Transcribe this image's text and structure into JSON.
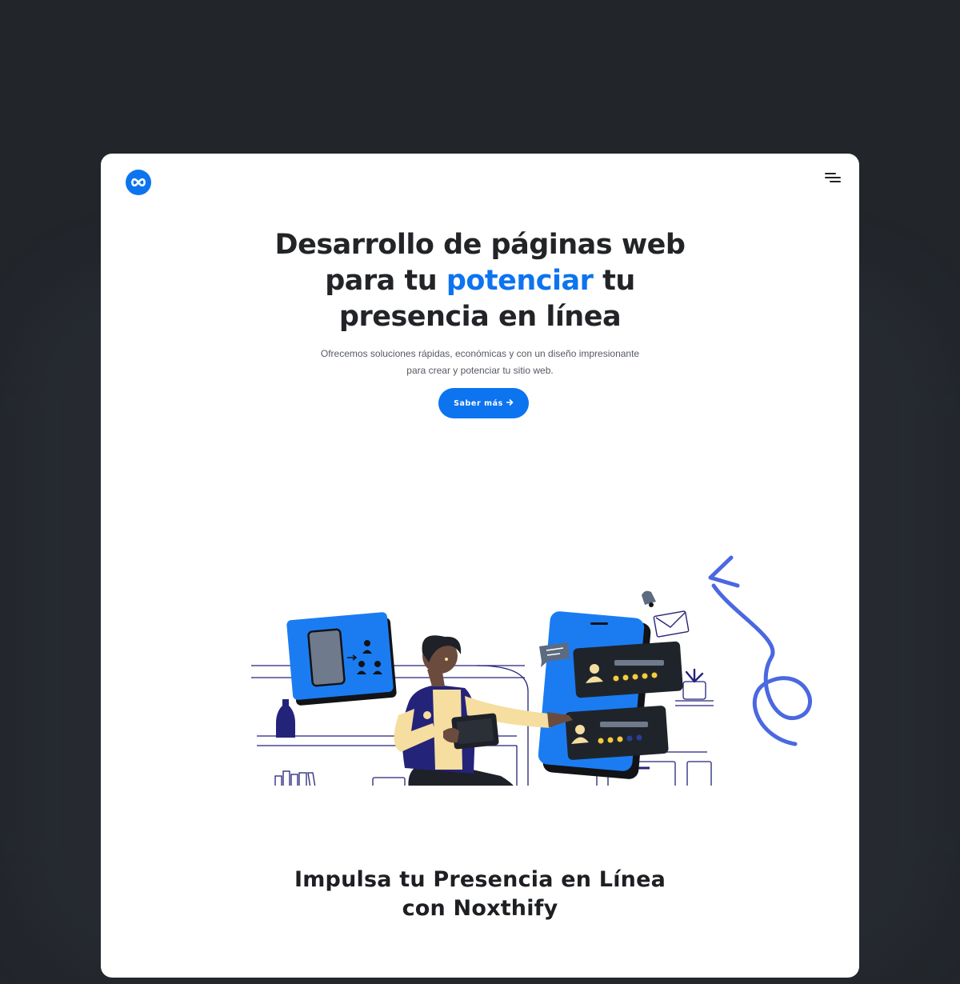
{
  "app": {
    "logo_icon": "infinity-icon",
    "menu_icon": "hamburger-menu-icon"
  },
  "hero": {
    "title_part1": "Desarrollo de páginas web para tu ",
    "title_accent": "potenciar",
    "title_part2": " tu presencia en línea",
    "subtitle": "Ofrecemos soluciones rápidas, económicas y con un diseño impresionante para crear y potenciar tu sitio web.",
    "cta_label": "Saber más",
    "cta_icon": "arrow-right-icon"
  },
  "section": {
    "title": "Impulsa tu Presencia en Línea con Noxthify"
  },
  "colors": {
    "background": "#22262b",
    "card": "#ffffff",
    "accent": "#0d74ef",
    "navy": "#24237a",
    "squiggle": "#4a68e0"
  }
}
